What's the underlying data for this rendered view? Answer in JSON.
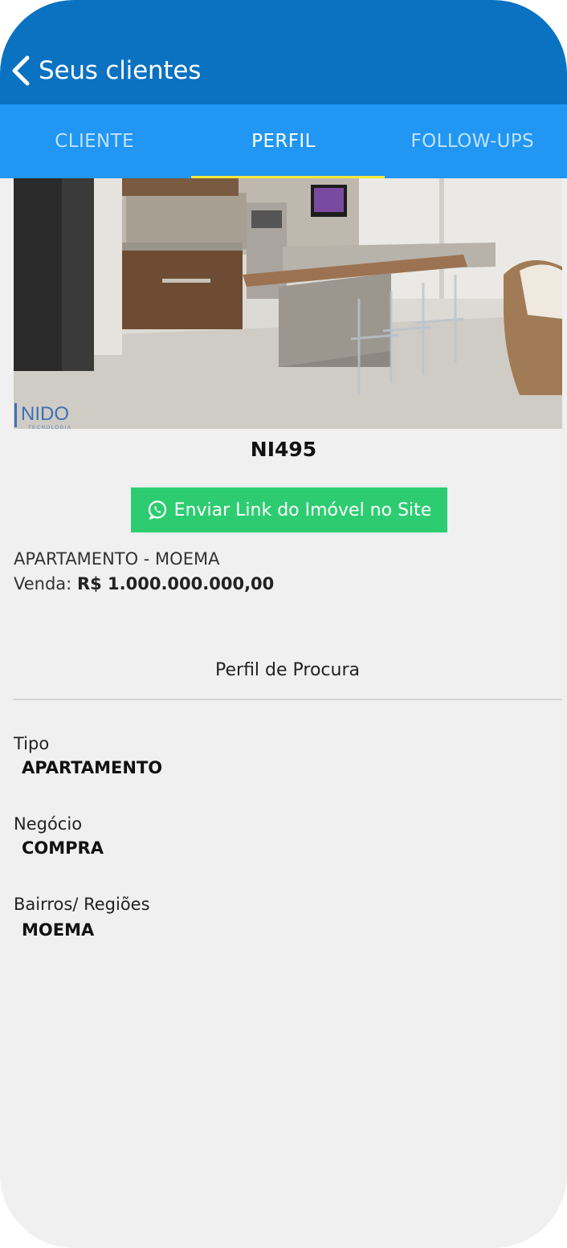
{
  "navbar": {
    "back_label": "Seus clientes"
  },
  "tabs": [
    {
      "label": "CLIENTE",
      "active": false
    },
    {
      "label": "PERFIL",
      "active": true
    },
    {
      "label": "FOLLOW-UPS",
      "active": false
    }
  ],
  "property": {
    "photo_logo": "NIDO",
    "photo_logo_sub": "TECNOLOGIA",
    "code": "NI495",
    "send_link_label": "Enviar Link do Imóvel no Site",
    "type_location": "APARTAMENTO - MOEMA",
    "price_label": "Venda:",
    "price_value": "R$ 1.000.000.000,00"
  },
  "profile": {
    "title": "Perfil de Procura",
    "fields": [
      {
        "label": "Tipo",
        "value": "APARTAMENTO"
      },
      {
        "label": "Negócio",
        "value": "COMPRA"
      },
      {
        "label": "Bairros/ Regiões",
        "value": "MOEMA"
      }
    ]
  },
  "colors": {
    "navbar": "#0b72c1",
    "tabs": "#2196f3",
    "tab_indicator": "#f4e83c",
    "whatsapp_button": "#2ecc71",
    "background": "#f0f0f0"
  },
  "icons": {
    "back": "chevron-left-icon",
    "whatsapp": "whatsapp-icon"
  }
}
